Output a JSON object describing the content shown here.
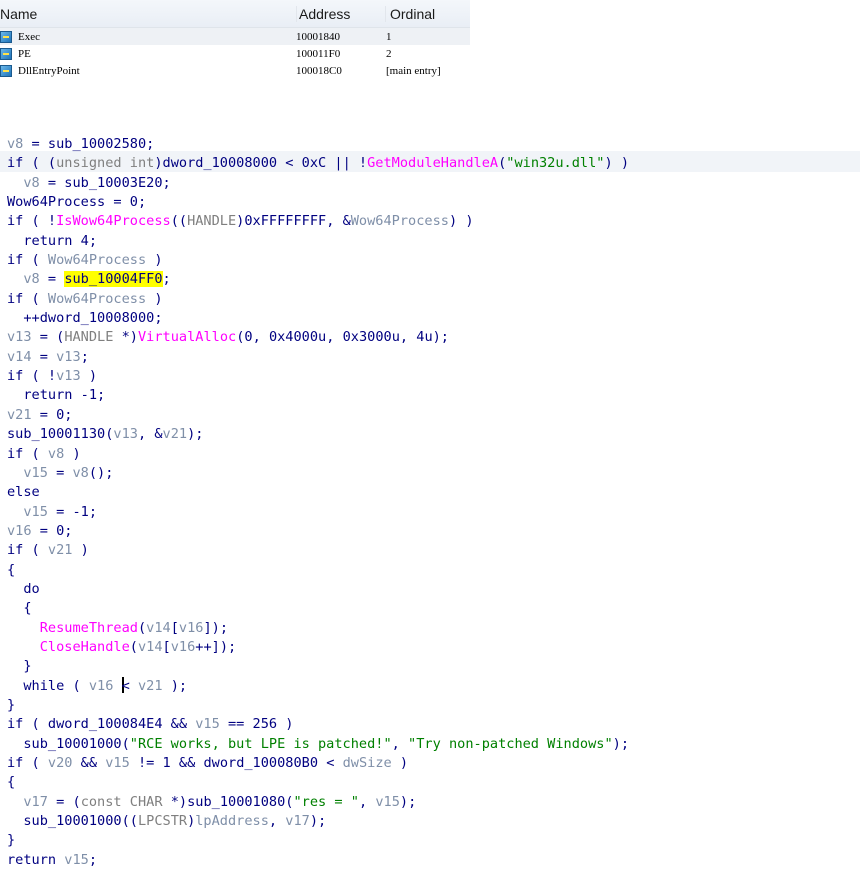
{
  "exports": {
    "headers": {
      "name": "Name",
      "address": "Address",
      "ordinal": "Ordinal"
    },
    "rows": [
      {
        "name": "Exec",
        "address": "10001840",
        "ordinal": "1"
      },
      {
        "name": "PE",
        "address": "100011F0",
        "ordinal": "2"
      },
      {
        "name": "DllEntryPoint",
        "address": "100018C0",
        "ordinal": "[main entry]"
      }
    ]
  },
  "pseudocode": {
    "highlighted_symbol": "sub_10004FF0",
    "lines": [
      "v8 = sub_10002580;",
      "if ( (unsigned int)dword_10008000 < 0xC || !GetModuleHandleA(\"win32u.dll\") )",
      "  v8 = sub_10003E20;",
      "Wow64Process = 0;",
      "if ( !IsWow64Process((HANDLE)0xFFFFFFFF, &Wow64Process) )",
      "  return 4;",
      "if ( Wow64Process )",
      "  v8 = sub_10004FF0;",
      "if ( Wow64Process )",
      "  ++dword_10008000;",
      "v13 = (HANDLE *)VirtualAlloc(0, 0x4000u, 0x3000u, 4u);",
      "v14 = v13;",
      "if ( !v13 )",
      "  return -1;",
      "v21 = 0;",
      "sub_10001130(v13, &v21);",
      "if ( v8 )",
      "  v15 = v8();",
      "else",
      "  v15 = -1;",
      "v16 = 0;",
      "if ( v21 )",
      "{",
      "  do",
      "  {",
      "    ResumeThread(v14[v16]);",
      "    CloseHandle(v14[v16++]);",
      "  }",
      "  while ( v16 < v21 );",
      "}",
      "if ( dword_100084E4 && v15 == 256 )",
      "  sub_10001000(\"RCE works, but LPE is patched!\", \"Try non-patched Windows\");",
      "if ( v20 && v15 != 1 && dword_100080B0 < dwSize )",
      "{",
      "  v17 = (const CHAR *)sub_10001080(\"res = \", v15);",
      "  sub_10001000((LPCSTR)lpAddress, v17);",
      "}",
      "return v15;"
    ]
  }
}
